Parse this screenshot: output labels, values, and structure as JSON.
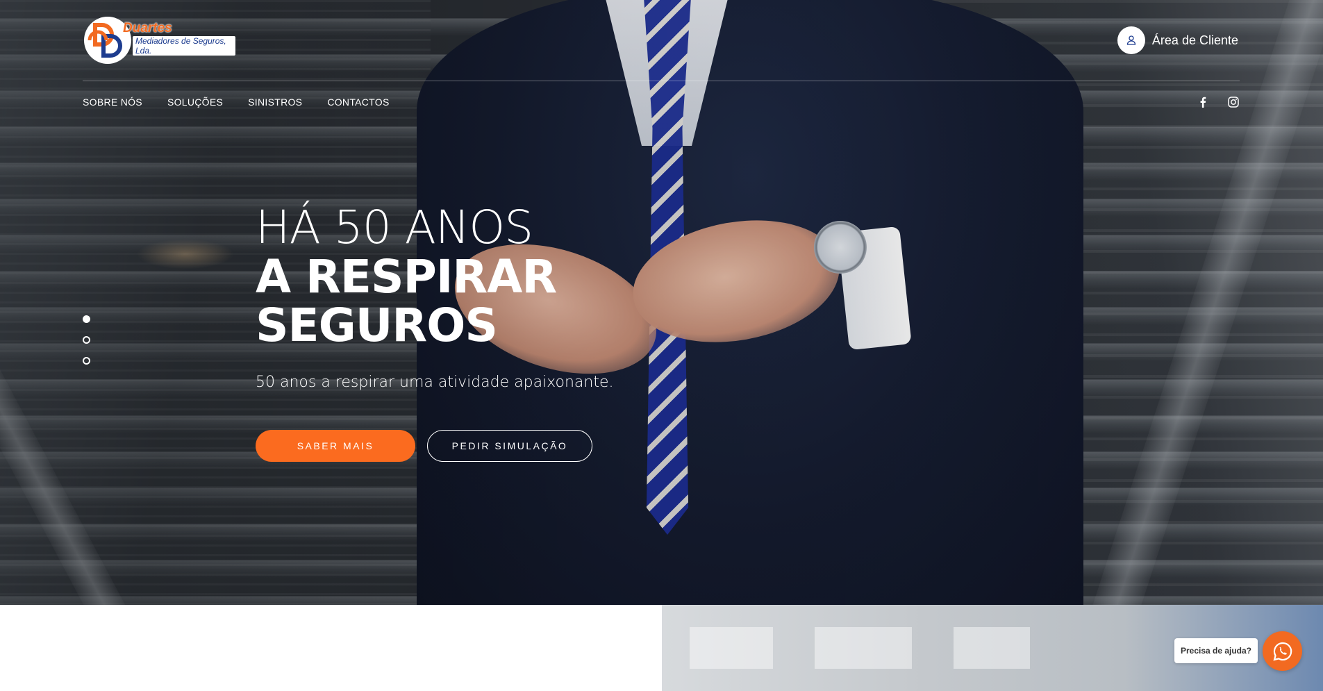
{
  "logo": {
    "name": "Duartes",
    "subtitle": "Mediadores de Seguros, Lda."
  },
  "header": {
    "client_area_label": "Área de Cliente",
    "client_icon": "user-icon"
  },
  "nav": {
    "items": [
      {
        "label": "SOBRE NÓS"
      },
      {
        "label": "SOLUÇÕES"
      },
      {
        "label": "SINISTROS"
      },
      {
        "label": "CONTACTOS"
      }
    ]
  },
  "social": {
    "icons": [
      "facebook-icon",
      "instagram-icon"
    ]
  },
  "slider": {
    "slide_count": 3,
    "active_index": 0
  },
  "hero": {
    "line1": "HÁ 50 ANOS",
    "line2": "A RESPIRAR",
    "line3": "SEGUROS",
    "subtitle": "50 anos a respirar uma atividade apaixonante.",
    "primary_button": "SABER MAIS",
    "secondary_button": "PEDIR SIMULAÇÃO"
  },
  "help_widget": {
    "label": "Precisa de ajuda?",
    "icon": "whatsapp-icon"
  },
  "colors": {
    "accent": "#fb6b1f",
    "brand_blue": "#1d3c8f",
    "white": "#ffffff"
  }
}
